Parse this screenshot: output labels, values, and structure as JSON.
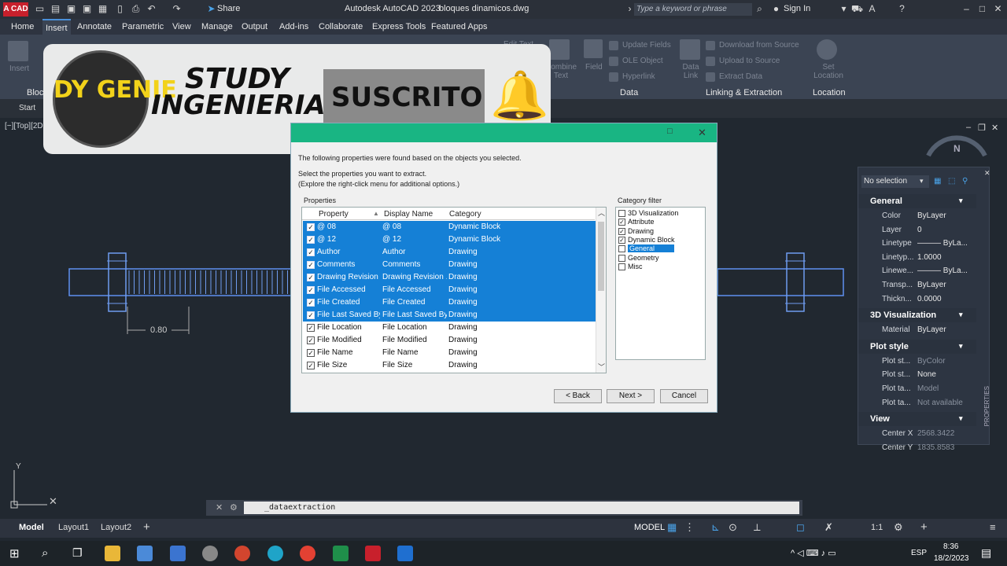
{
  "titlebar": {
    "app_badge": "A CAD",
    "share": "Share",
    "title": "Autodesk AutoCAD 2023",
    "filename": "bloques dinamicos.dwg",
    "search_placeholder": "Type a keyword or phrase",
    "signin": "Sign In"
  },
  "menu": {
    "tabs": [
      "Home",
      "Insert",
      "Annotate",
      "Parametric",
      "View",
      "Manage",
      "Output",
      "Add-ins",
      "Collaborate",
      "Express Tools",
      "Featured Apps"
    ],
    "active": "Insert"
  },
  "ribbon": {
    "panels": {
      "block": "Block",
      "data": "Data",
      "linking": "Linking & Extraction",
      "location": "Location"
    },
    "insert_label": "Insert",
    "items": {
      "edit_text": "Edit Text",
      "combine_text": "Combine Text",
      "field": "Field",
      "update_fields": "Update Fields",
      "ole_object": "OLE Object",
      "hyperlink": "Hyperlink",
      "data_link": "Data Link",
      "download_source": "Download from Source",
      "upload_source": "Upload to Source",
      "extract_data": "Extract  Data",
      "set_location": "Set Location"
    }
  },
  "filetabs": {
    "start": "Start"
  },
  "viewport": {
    "label": "[−][Top][2D",
    "dimension": "0.80",
    "compass_n": "N",
    "ucs_y": "Y"
  },
  "banner": {
    "logo_text": "DY GENIE",
    "title_line1": "STUDY",
    "title_line2": "INGENIERIA",
    "subscribed": "SUSCRITO"
  },
  "dialog": {
    "intro": "The following properties were found based on the objects you selected.",
    "instructions_line1": "Select the properties you want to extract.",
    "instructions_line2": "(Explore the right-click menu for additional options.)",
    "properties_label": "Properties",
    "columns": [
      "Property",
      "Display Name",
      "Category"
    ],
    "rows": [
      {
        "property": "@ 08",
        "display": "@ 08",
        "category": "Dynamic Block",
        "selected": true
      },
      {
        "property": "@ 12",
        "display": "@ 12",
        "category": "Dynamic Block",
        "selected": true
      },
      {
        "property": "Author",
        "display": "Author",
        "category": "Drawing",
        "selected": true
      },
      {
        "property": "Comments",
        "display": "Comments",
        "category": "Drawing",
        "selected": true
      },
      {
        "property": "Drawing Revision ...",
        "display": "Drawing Revision ...",
        "category": "Drawing",
        "selected": true
      },
      {
        "property": "File Accessed",
        "display": "File Accessed",
        "category": "Drawing",
        "selected": true
      },
      {
        "property": "File Created",
        "display": "File Created",
        "category": "Drawing",
        "selected": true
      },
      {
        "property": "File Last Saved By",
        "display": "File Last Saved By",
        "category": "Drawing",
        "selected": true
      },
      {
        "property": "File Location",
        "display": "File Location",
        "category": "Drawing",
        "selected": false
      },
      {
        "property": "File Modified",
        "display": "File Modified",
        "category": "Drawing",
        "selected": false
      },
      {
        "property": "File Name",
        "display": "File Name",
        "category": "Drawing",
        "selected": false
      },
      {
        "property": "File Size",
        "display": "File Size",
        "category": "Drawing",
        "selected": false
      }
    ],
    "category_filter_label": "Category filter",
    "categories": [
      {
        "label": "3D Visualization",
        "checked": false,
        "selected": false
      },
      {
        "label": "Attribute",
        "checked": true,
        "selected": false
      },
      {
        "label": "Drawing",
        "checked": true,
        "selected": false
      },
      {
        "label": "Dynamic Block",
        "checked": true,
        "selected": false
      },
      {
        "label": "General",
        "checked": false,
        "selected": true
      },
      {
        "label": "Geometry",
        "checked": false,
        "selected": false
      },
      {
        "label": "Misc",
        "checked": false,
        "selected": false
      }
    ],
    "back": "< Back",
    "next": "Next >",
    "cancel": "Cancel"
  },
  "properties_palette": {
    "selection": "No selection",
    "side_title": "PROPERTIES",
    "sections": {
      "general": "General",
      "viz": "3D Visualization",
      "plot": "Plot style",
      "view": "View"
    },
    "general": [
      {
        "k": "Color",
        "v": "ByLayer"
      },
      {
        "k": "Layer",
        "v": "0"
      },
      {
        "k": "Linetype",
        "v": "——— ByLa..."
      },
      {
        "k": "Linetyp...",
        "v": "1.0000"
      },
      {
        "k": "Linewe...",
        "v": "——— ByLa..."
      },
      {
        "k": "Transp...",
        "v": "ByLayer"
      },
      {
        "k": "Thickn...",
        "v": "0.0000"
      }
    ],
    "viz": [
      {
        "k": "Material",
        "v": "ByLayer"
      }
    ],
    "plot": [
      {
        "k": "Plot st...",
        "v": "ByColor"
      },
      {
        "k": "Plot st...",
        "v": "None"
      },
      {
        "k": "Plot ta...",
        "v": "Model"
      },
      {
        "k": "Plot ta...",
        "v": "Not available"
      }
    ],
    "view": [
      {
        "k": "Center X",
        "v": "2568.3422"
      },
      {
        "k": "Center Y",
        "v": "1835.8583"
      }
    ]
  },
  "commandline": {
    "text": "_dataextraction"
  },
  "statusbar": {
    "model_tab": "Model",
    "layout1": "Layout1",
    "layout2": "Layout2",
    "model": "MODEL",
    "scale": "1:1"
  },
  "taskbar": {
    "time": "8:36",
    "date": "18/2/2023",
    "lang": "ESP"
  },
  "colors": {
    "accent": "#1580d6",
    "dialog_header": "#19b583",
    "cad_red": "#c8202c"
  }
}
